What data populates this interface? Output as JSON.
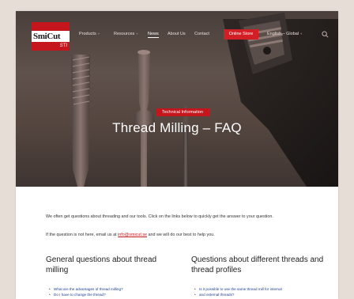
{
  "header": {
    "logo_text": "SmiCut",
    "logo_sub": "STI",
    "nav": [
      {
        "label": "Products",
        "has_caret": true
      },
      {
        "label": "Resources",
        "has_caret": true
      },
      {
        "label": "News",
        "has_caret": false,
        "active": true
      },
      {
        "label": "About Us",
        "has_caret": false
      },
      {
        "label": "Contact",
        "has_caret": false
      }
    ],
    "shop_button": "Online Store",
    "language": "English – Global",
    "language_caret": "˅",
    "caret": "˅"
  },
  "hero": {
    "tag": "Technical Information",
    "title": "Thread Milling – FAQ"
  },
  "intro": {
    "line1": "We often get questions about threading and our tools. Click on the links below to quickly get the answer to your question.",
    "line2_before": "If the question is not here, email us at ",
    "email": "info@smicut.se",
    "line2_after": " and we will do our best to help you."
  },
  "columns": [
    {
      "heading": "General questions about thread milling",
      "items": [
        "What are the advantages of thread milling?",
        "Do I have to change the thread?"
      ]
    },
    {
      "heading": "Questions about different threads and thread profiles",
      "items": [
        "Is it possible to use the same thread mill for internal",
        "and external threads?"
      ]
    }
  ],
  "colors": {
    "brand_red": "#c4161c",
    "link_blue": "#1f3d8a",
    "hero_bg": "#54463f"
  }
}
